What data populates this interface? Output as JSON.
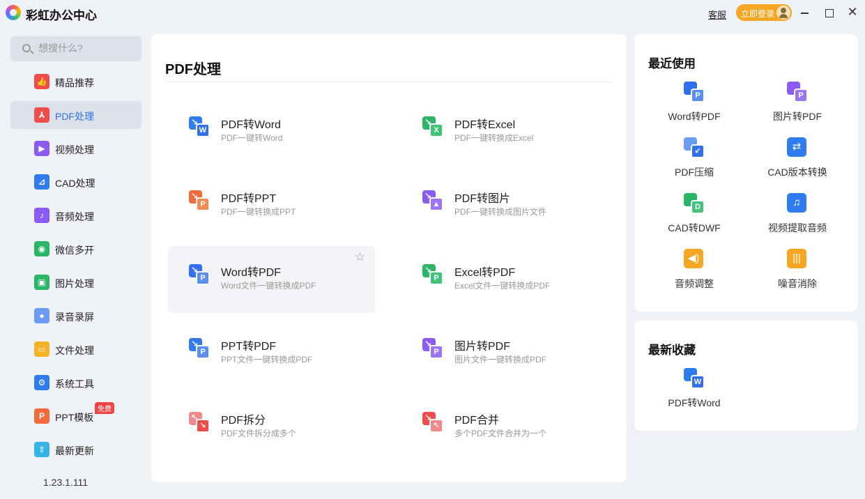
{
  "app": {
    "title": "彩虹办公中心",
    "service_label": "客服",
    "login_label": "立即登录"
  },
  "search": {
    "placeholder": "想搜什么?"
  },
  "sidebar": {
    "items": [
      {
        "label": "精品推荐",
        "icon": "thumbs-up-icon",
        "color": "#f04c4c"
      },
      {
        "label": "PDF处理",
        "icon": "pdf-icon",
        "color": "#f04c4c"
      },
      {
        "label": "视频处理",
        "icon": "play-icon",
        "color": "#8a5cf5"
      },
      {
        "label": "CAD处理",
        "icon": "cad-icon",
        "color": "#2f7cf0"
      },
      {
        "label": "音频处理",
        "icon": "music-note-icon",
        "color": "#8a5cf5"
      },
      {
        "label": "微信多开",
        "icon": "wechat-icon",
        "color": "#2bb567"
      },
      {
        "label": "图片处理",
        "icon": "image-icon",
        "color": "#2bb567"
      },
      {
        "label": "录音录屏",
        "icon": "microphone-icon",
        "color": "#6a9bf5"
      },
      {
        "label": "文件处理",
        "icon": "folder-icon",
        "color": "#f5b323"
      },
      {
        "label": "系统工具",
        "icon": "gear-icon",
        "color": "#2f7cf0"
      },
      {
        "label": "PPT模板",
        "icon": "ppt-icon",
        "color": "#f06a3c",
        "badge": "免费"
      },
      {
        "label": "最新更新",
        "icon": "upload-icon",
        "color": "#35b4e8"
      }
    ],
    "active_index": 1,
    "version": "1.23.1.111"
  },
  "main": {
    "title": "PDF处理",
    "tools": [
      {
        "name": "PDF转Word",
        "desc": "PDF一键转Word",
        "back": "#2f7cf0",
        "front": "#2f6ff0",
        "letter": "W",
        "arrow": "↘"
      },
      {
        "name": "PDF转Excel",
        "desc": "PDF一键转换成Excel",
        "back": "#2bb567",
        "front": "#3fc47a",
        "letter": "X",
        "arrow": "↘"
      },
      {
        "name": "PDF转PPT",
        "desc": "PDF一键转换成PPT",
        "back": "#f06a3c",
        "front": "#f5894f",
        "letter": "P",
        "arrow": "↘"
      },
      {
        "name": "PDF转图片",
        "desc": "PDF一键转换成图片文件",
        "back": "#8a5cf5",
        "front": "#9d74f7",
        "letter": "▲",
        "arrow": "↘"
      },
      {
        "name": "Word转PDF",
        "desc": "Word文件一键转换成PDF",
        "back": "#2f6ff0",
        "front": "#5b8ef5",
        "letter": "P",
        "arrow": "↘"
      },
      {
        "name": "Excel转PDF",
        "desc": "Excel文件一键转换成PDF",
        "back": "#2bb567",
        "front": "#3fc47a",
        "letter": "P",
        "arrow": "↘"
      },
      {
        "name": "PPT转PDF",
        "desc": "PPT文件一键转换成PDF",
        "back": "#2f7cf0",
        "front": "#5b8ef5",
        "letter": "P",
        "arrow": "↘"
      },
      {
        "name": "图片转PDF",
        "desc": "图片文件一键转换成PDF",
        "back": "#8a5cf5",
        "front": "#9d74f7",
        "letter": "P",
        "arrow": "↘"
      },
      {
        "name": "PDF拆分",
        "desc": "PDF文件拆分成多个",
        "back": "#f08a8a",
        "front": "#f04c4c",
        "letter": "↘",
        "arrow": "↖"
      },
      {
        "name": "PDF合并",
        "desc": "多个PDF文件合并为一个",
        "back": "#f04c4c",
        "front": "#f08a8a",
        "letter": "↖",
        "arrow": "↘"
      }
    ]
  },
  "recent": {
    "title": "最近使用",
    "items": [
      {
        "label": "Word转PDF",
        "back": "#2f6ff0",
        "front": "#5b8ef5",
        "letter": "P"
      },
      {
        "label": "图片转PDF",
        "back": "#8a5cf5",
        "front": "#9d74f7",
        "letter": "P"
      },
      {
        "label": "PDF压缩",
        "back": "#6a9bf5",
        "front": "#2f6ff0",
        "letter": "↙"
      },
      {
        "label": "CAD版本转换",
        "solid": "#2f7cf0",
        "glyph": "⇄"
      },
      {
        "label": "CAD转DWF",
        "back": "#2bb567",
        "front": "#3fc47a",
        "letter": "D"
      },
      {
        "label": "视频提取音频",
        "solid": "#2f7cf0",
        "glyph": "♫"
      },
      {
        "label": "音频调整",
        "solid": "#f5a623",
        "glyph": "◀)"
      },
      {
        "label": "噪音消除",
        "solid": "#f5a623",
        "glyph": "|||"
      }
    ]
  },
  "favorites": {
    "title": "最新收藏",
    "items": [
      {
        "label": "PDF转Word",
        "back": "#2f7cf0",
        "front": "#2f6ff0",
        "letter": "W"
      }
    ]
  },
  "hover_tool_index": 4
}
